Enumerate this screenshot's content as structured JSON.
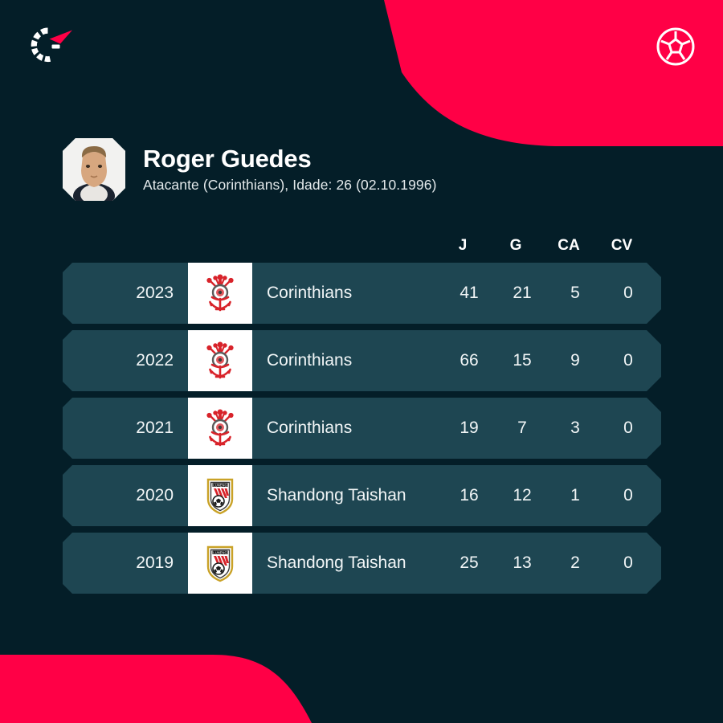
{
  "theme": {
    "background": "#041e28",
    "accent_red": "#ff0046",
    "row_background": "#1e4652",
    "text_primary": "#ffffff",
    "crest_cell": "#ffffff"
  },
  "header": {
    "brand_logo_icon": "flashscore-arc-arrow-logo",
    "ball_icon": "soccer-ball-icon"
  },
  "player": {
    "avatar_icon": "player-portrait-avatar",
    "name": "Roger Guedes",
    "meta": "Atacante (Corinthians), Idade: 26 (02.10.1996)"
  },
  "table": {
    "columns": [
      {
        "key": "J",
        "label": "J"
      },
      {
        "key": "G",
        "label": "G"
      },
      {
        "key": "CA",
        "label": "CA"
      },
      {
        "key": "CV",
        "label": "CV"
      }
    ],
    "rows": [
      {
        "season": "2023",
        "crest_icon": "corinthians-crest",
        "team": "Corinthians",
        "J": "41",
        "G": "21",
        "CA": "5",
        "CV": "0"
      },
      {
        "season": "2022",
        "crest_icon": "corinthians-crest",
        "team": "Corinthians",
        "J": "66",
        "G": "15",
        "CA": "9",
        "CV": "0"
      },
      {
        "season": "2021",
        "crest_icon": "corinthians-crest",
        "team": "Corinthians",
        "J": "19",
        "G": "7",
        "CA": "3",
        "CV": "0"
      },
      {
        "season": "2020",
        "crest_icon": "shandong-taishan-crest",
        "team": "Shandong Taishan",
        "J": "16",
        "G": "12",
        "CA": "1",
        "CV": "0"
      },
      {
        "season": "2019",
        "crest_icon": "shandong-taishan-crest",
        "team": "Shandong Taishan",
        "J": "25",
        "G": "13",
        "CA": "2",
        "CV": "0"
      }
    ]
  }
}
